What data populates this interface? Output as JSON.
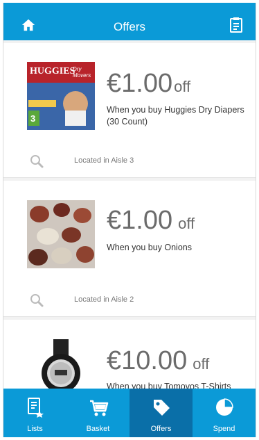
{
  "header": {
    "title": "Offers",
    "home_icon": "home-icon",
    "notes_icon": "notepad-icon"
  },
  "offers": [
    {
      "amount": "€1.00",
      "off": "off",
      "description": "When you buy Huggies Dry Diapers (30 Count)",
      "location": "Located in Aisle 3",
      "brand_text": "HUGGIES",
      "brand_sub": "Dry Movers",
      "size_badge": "3"
    },
    {
      "amount": "€1.00",
      "off": "off",
      "description": "When you buy Onions",
      "location": "Located in Aisle 2"
    },
    {
      "amount": "€10.00",
      "off": "off",
      "description": "When you buy Tomovos T-Shirts"
    }
  ],
  "tabs": [
    {
      "label": "Lists",
      "icon": "list-icon"
    },
    {
      "label": "Basket",
      "icon": "cart-icon"
    },
    {
      "label": "Offers",
      "icon": "tag-icon",
      "active": true
    },
    {
      "label": "Spend",
      "icon": "pie-chart-icon"
    }
  ],
  "colors": {
    "primary": "#0b9ad7",
    "active_tab": "#0a6fa8"
  }
}
